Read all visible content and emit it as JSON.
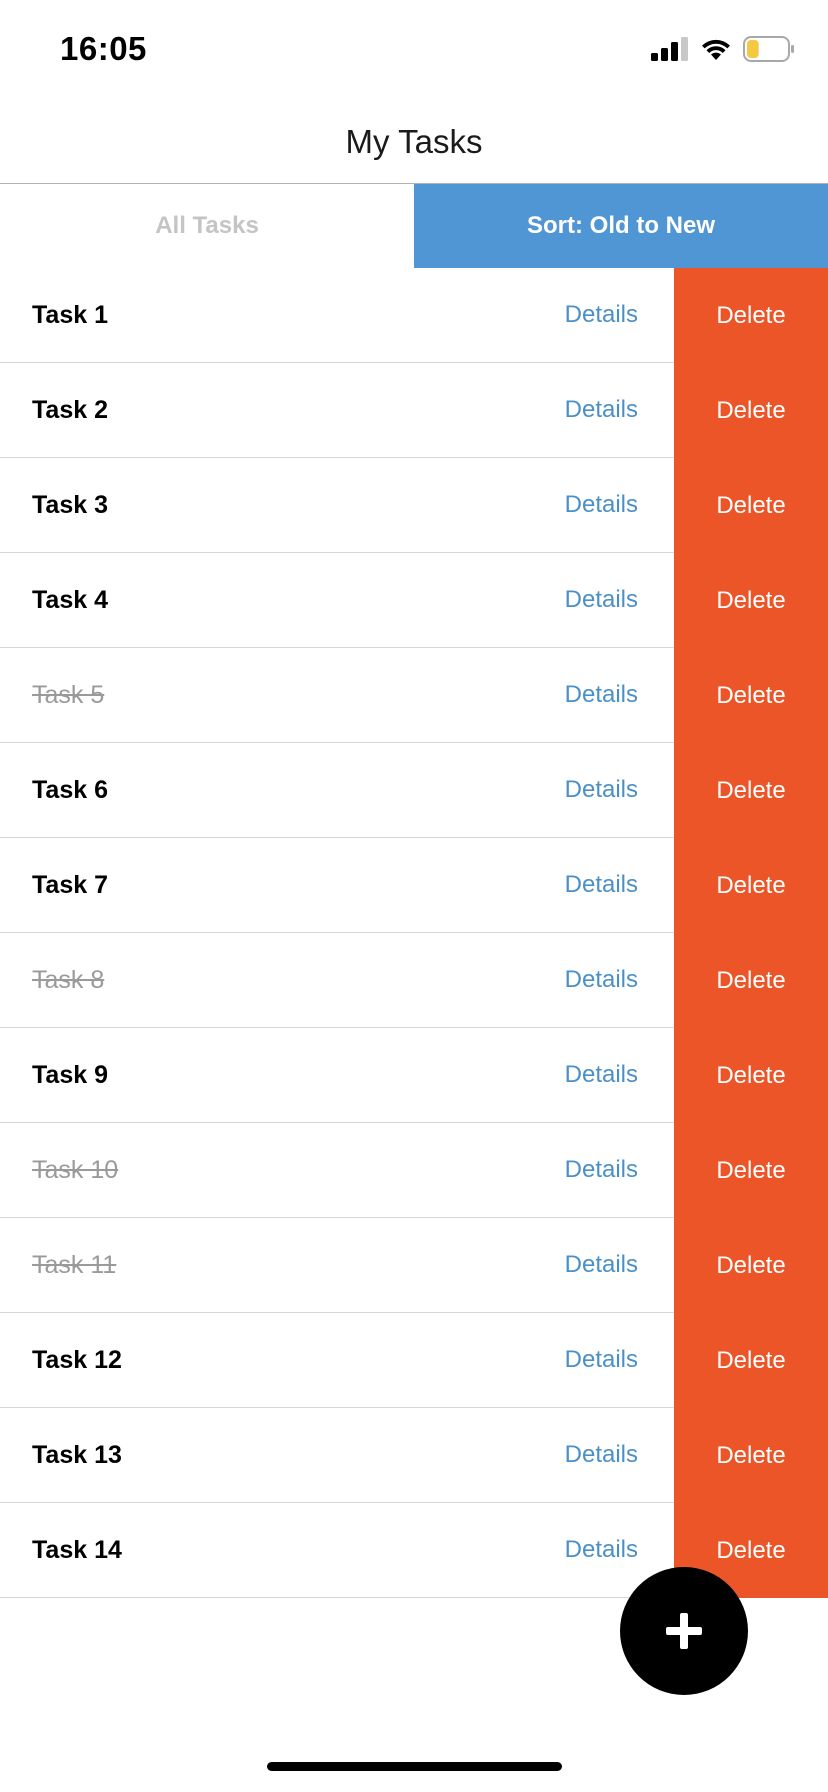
{
  "status_bar": {
    "time": "16:05",
    "icons": [
      "cellular-signal-icon",
      "wifi-icon",
      "battery-icon"
    ],
    "battery_fill_color": "#f5c842",
    "battery_level": 0.3
  },
  "header": {
    "title": "My Tasks"
  },
  "tabs": {
    "all_label": "All Tasks",
    "sort_label": "Sort: Old to New",
    "active": "sort",
    "active_color": "#5096d4"
  },
  "tasks": [
    {
      "title": "Task 1",
      "completed": false
    },
    {
      "title": "Task 2",
      "completed": false
    },
    {
      "title": "Task 3",
      "completed": false
    },
    {
      "title": "Task 4",
      "completed": false
    },
    {
      "title": "Task 5",
      "completed": true
    },
    {
      "title": "Task 6",
      "completed": false
    },
    {
      "title": "Task 7",
      "completed": false
    },
    {
      "title": "Task 8",
      "completed": true
    },
    {
      "title": "Task 9",
      "completed": false
    },
    {
      "title": "Task 10",
      "completed": true
    },
    {
      "title": "Task 11",
      "completed": true
    },
    {
      "title": "Task 12",
      "completed": false
    },
    {
      "title": "Task 13",
      "completed": false
    },
    {
      "title": "Task 14",
      "completed": false
    }
  ],
  "row_actions": {
    "details_label": "Details",
    "delete_label": "Delete",
    "details_color": "#4a90c8",
    "delete_color": "#eb5528"
  },
  "fab": {
    "icon": "plus-icon"
  }
}
